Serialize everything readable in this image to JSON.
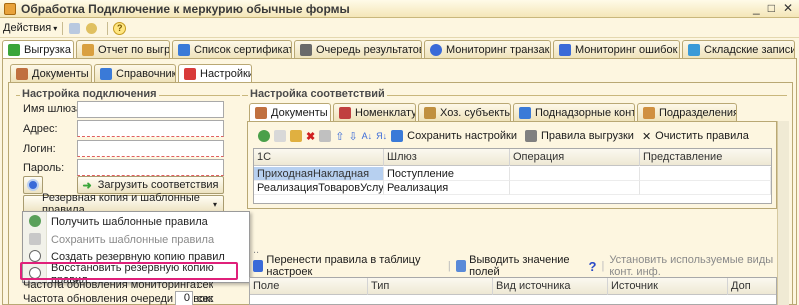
{
  "window": {
    "title": "Обработка  Подключение к меркурию обычные формы",
    "controls": [
      "_",
      "□",
      "✕"
    ]
  },
  "toolbar": {
    "actions_label": "Действия",
    "help_label": "?"
  },
  "top_tabs": [
    {
      "label": "Выгрузка",
      "color": "#3aa53a"
    },
    {
      "label": "Отчет по выгрузке",
      "color": "#d9a040"
    },
    {
      "label": "Список сертификатов...",
      "color": "#3a7ad8"
    },
    {
      "label": "Очередь результатов...",
      "color": "#6a6a6a"
    },
    {
      "label": "Мониторинг транзак...",
      "color": "#3a6ad8"
    },
    {
      "label": "Мониторинг ошибок",
      "color": "#3a6ad8"
    },
    {
      "label": "Складские записи",
      "color": "#3a9ad8"
    }
  ],
  "sub_tabs": [
    {
      "label": "Документы",
      "color": "#c07040"
    },
    {
      "label": "Справочники",
      "color": "#3a7ad8"
    },
    {
      "label": "Настройки",
      "color": "#d83a3a"
    }
  ],
  "connection": {
    "title": "Настройка подключения",
    "gateway_label": "Имя шлюза:",
    "address_label": "Адрес:",
    "login_label": "Логин:",
    "password_label": "Пароль:",
    "load_button": "Загрузить соответствия",
    "backup_dropdown": "Резервная копия и шаблонные правила"
  },
  "backup_menu": {
    "items": [
      {
        "label": "Получить шаблонные правила",
        "disabled": false
      },
      {
        "label": "Сохранить шаблонные правила",
        "disabled": true
      },
      {
        "label": "Создать резервную копию правил",
        "disabled": false
      },
      {
        "label": "Восстановить резервную копию правил",
        "disabled": false
      }
    ]
  },
  "bottom_left": {
    "monitoring_label": "Частота обновления мониторинга:",
    "queue_label": "Частота обновления очереди заявок:",
    "queue_value": "0",
    "unit": "сек"
  },
  "mapping": {
    "title": "Настройка соответствий",
    "tabs": [
      {
        "label": "Документы",
        "color": "#c07040"
      },
      {
        "label": "Номенклатура",
        "color": "#c04040"
      },
      {
        "label": "Хоз. субъекты",
        "color": "#c09040"
      },
      {
        "label": "Поднадзорные контр.",
        "color": "#3a7ad8"
      },
      {
        "label": "Подразделения",
        "color": "#d09040"
      }
    ],
    "toolbar": {
      "save_settings": "Сохранить настройки",
      "upload_rules": "Правила выгрузки",
      "clear_rules": "Очистить правила"
    },
    "columns": [
      "1С",
      "Шлюз",
      "Операция",
      "Представление"
    ],
    "rows": [
      [
        "ПриходнаяНакладная",
        "Поступление",
        "",
        ""
      ],
      [
        "РеализацияТоваровУслуг",
        "Реализация",
        "",
        ""
      ]
    ]
  },
  "lower": {
    "move_rules": "Перенести правила в таблицу настроек",
    "show_fields": "Выводить значение полей",
    "set_types": "Установить используемые виды конт. инф.",
    "columns": [
      "Поле",
      "Тип",
      "Вид источника",
      "Источник",
      "Доп"
    ]
  }
}
